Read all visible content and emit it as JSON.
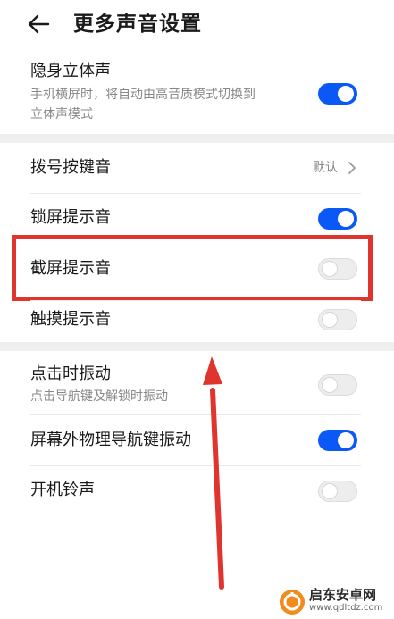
{
  "header": {
    "title": "更多声音设置",
    "back_icon": "arrow-left-icon"
  },
  "settings": {
    "stealth_stereo": {
      "label": "隐身立体声",
      "desc_line1": "手机横屏时，将自动由高音质模式切换到",
      "desc_line2": "立体声模式",
      "enabled": true
    },
    "dial_tone": {
      "label": "拨号按键音",
      "value": "默认"
    },
    "lock_sound": {
      "label": "锁屏提示音",
      "enabled": true
    },
    "screenshot_sound": {
      "label": "截屏提示音",
      "enabled": false
    },
    "touch_sound": {
      "label": "触摸提示音",
      "enabled": false
    },
    "click_vibration": {
      "label": "点击时振动",
      "desc": "点击导航键及解锁时振动",
      "enabled": false
    },
    "nav_key_vibration": {
      "label": "屏幕外物理导航键振动",
      "enabled": true
    },
    "boot_ringtone": {
      "label": "开机铃声",
      "enabled": false
    }
  },
  "colors": {
    "accent": "#0a59f7",
    "highlight": "#e0342e"
  },
  "watermark": {
    "name": "启东安卓网",
    "url": "www.qdltdz.com"
  }
}
